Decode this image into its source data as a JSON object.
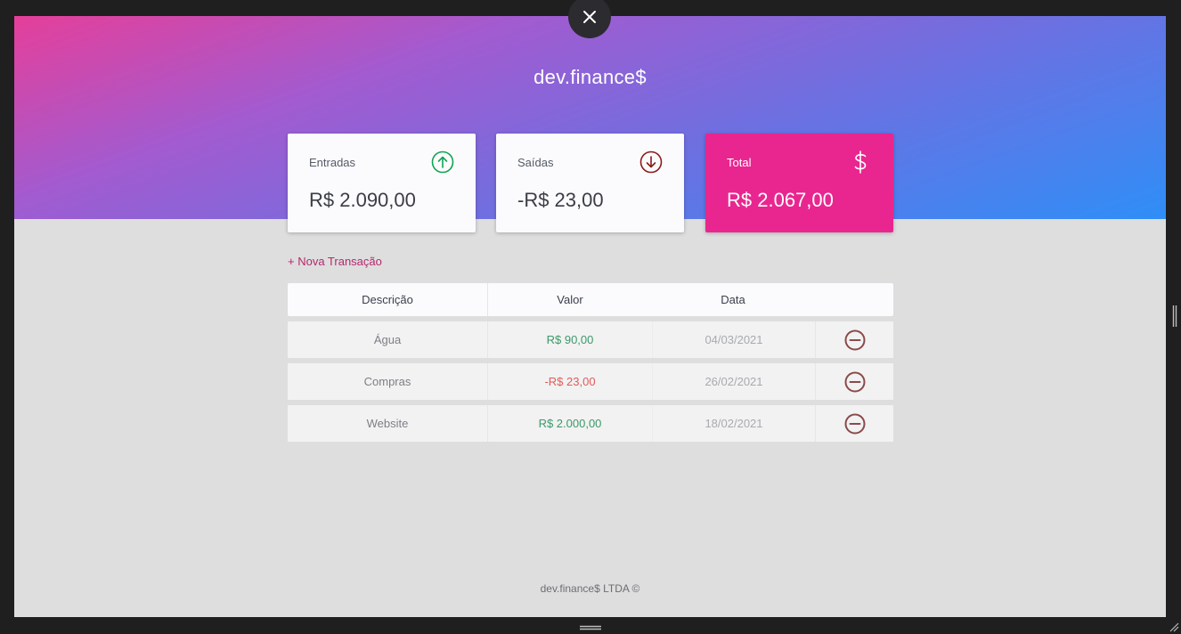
{
  "app": {
    "brand": "dev.finance$"
  },
  "summary": {
    "income": {
      "label": "Entradas",
      "amount": "R$ 2.090,00",
      "icon": "arrow-up-circle-icon",
      "color": "#12a454"
    },
    "expense": {
      "label": "Saídas",
      "amount": "-R$ 23,00",
      "icon": "arrow-down-circle-icon",
      "color": "#8b1a1a"
    },
    "total": {
      "label": "Total",
      "amount": "R$ 2.067,00",
      "icon": "dollar-sign-icon",
      "color": "#e9268f"
    }
  },
  "actions": {
    "new_transaction": "+ Nova Transação"
  },
  "table": {
    "headers": {
      "description": "Descrição",
      "amount": "Valor",
      "date": "Data"
    },
    "rows": [
      {
        "description": "Água",
        "amount": "R$ 90,00",
        "date": "04/03/2021",
        "type": "income"
      },
      {
        "description": "Compras",
        "amount": "-R$ 23,00",
        "date": "26/02/2021",
        "type": "expense"
      },
      {
        "description": "Website",
        "amount": "R$ 2.000,00",
        "date": "18/02/2021",
        "type": "income"
      }
    ]
  },
  "footer": {
    "text": "dev.finance$ LTDA ©"
  },
  "colors": {
    "income_text": "#3a9a6a",
    "expense_text": "#e35a5a",
    "remove_icon": "#8b4a4a",
    "hero_start": "#e53f9a",
    "hero_end": "#2f8ef7"
  }
}
